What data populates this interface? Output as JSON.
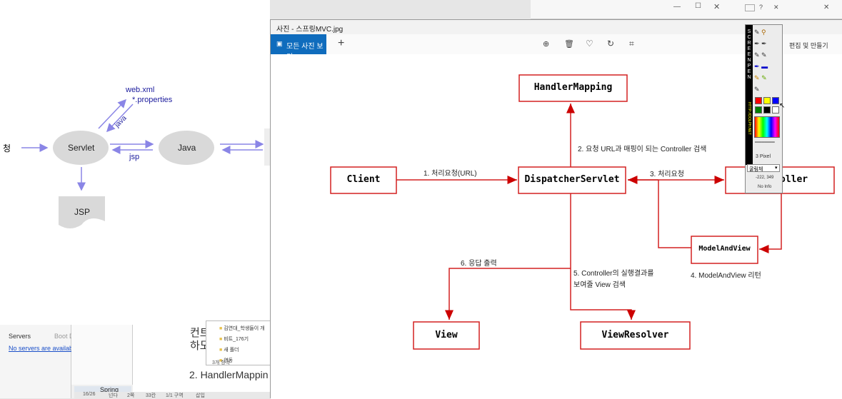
{
  "bg_slide": {
    "labels": {
      "left_cut": "청",
      "servlet": "Servlet",
      "java": "Java",
      "jsp_doc": "JSP",
      "webxml": "web.xml",
      "props": "*.properties",
      "java_arrow": "java",
      "jsp_arrow": "jsp"
    }
  },
  "bg_right_window": {
    "menu": "편집 및 만들기"
  },
  "eclipse": {
    "tab_servers": "Servers",
    "tab_boot": "Boot D",
    "no_servers": "No servers are available. C",
    "project_tab": "Spring",
    "status_cells": [
      "16/26",
      "넌다",
      "2쪽",
      "33칸",
      "1/1 구역",
      "삽입"
    ]
  },
  "explorer_popup": {
    "items": [
      "김연대_학생들이 개",
      "비트_176기",
      "새 폴더",
      "연동"
    ],
    "count": "3개 항목"
  },
  "doc_text": {
    "line1": "컨트",
    "line2": "하도",
    "line3": "2. HandlerMappin"
  },
  "viewer": {
    "title": "사진 - 스프링MVC.jpg",
    "all_photos": "모든 사진 보기",
    "edit": "편집 및 만들기"
  },
  "diagram": {
    "nodes": {
      "handler_mapping": "HandlerMapping",
      "client": "Client",
      "dispatcher": "DispatcherServlet",
      "controller": "Controller",
      "model_and_view": "ModelAndView",
      "view": "View",
      "view_resolver": "ViewResolver"
    },
    "edges": {
      "e1": "1. 처리요청(URL)",
      "e2": "2. 요청 URL과 매핑이 되는 Controller 검색",
      "e3": "3. 처리요청",
      "e4": "4. ModelAndView 리턴",
      "e5a": "5. Controller의 실행결과를",
      "e5b": "보여줄 View 검색",
      "e6": "6. 응답 출력"
    }
  },
  "screen_pen": {
    "vertical_text": "SCREEN PEN",
    "sub_text": "HTTP://DOLPH.NET",
    "font": "굴림체",
    "size": "3 Pixel",
    "coords": "-222, 349",
    "info": "No Info",
    "colors": [
      "#ff0000",
      "#ffff00",
      "#0000ff",
      "#008000",
      "#000000",
      "#ffffff"
    ]
  }
}
